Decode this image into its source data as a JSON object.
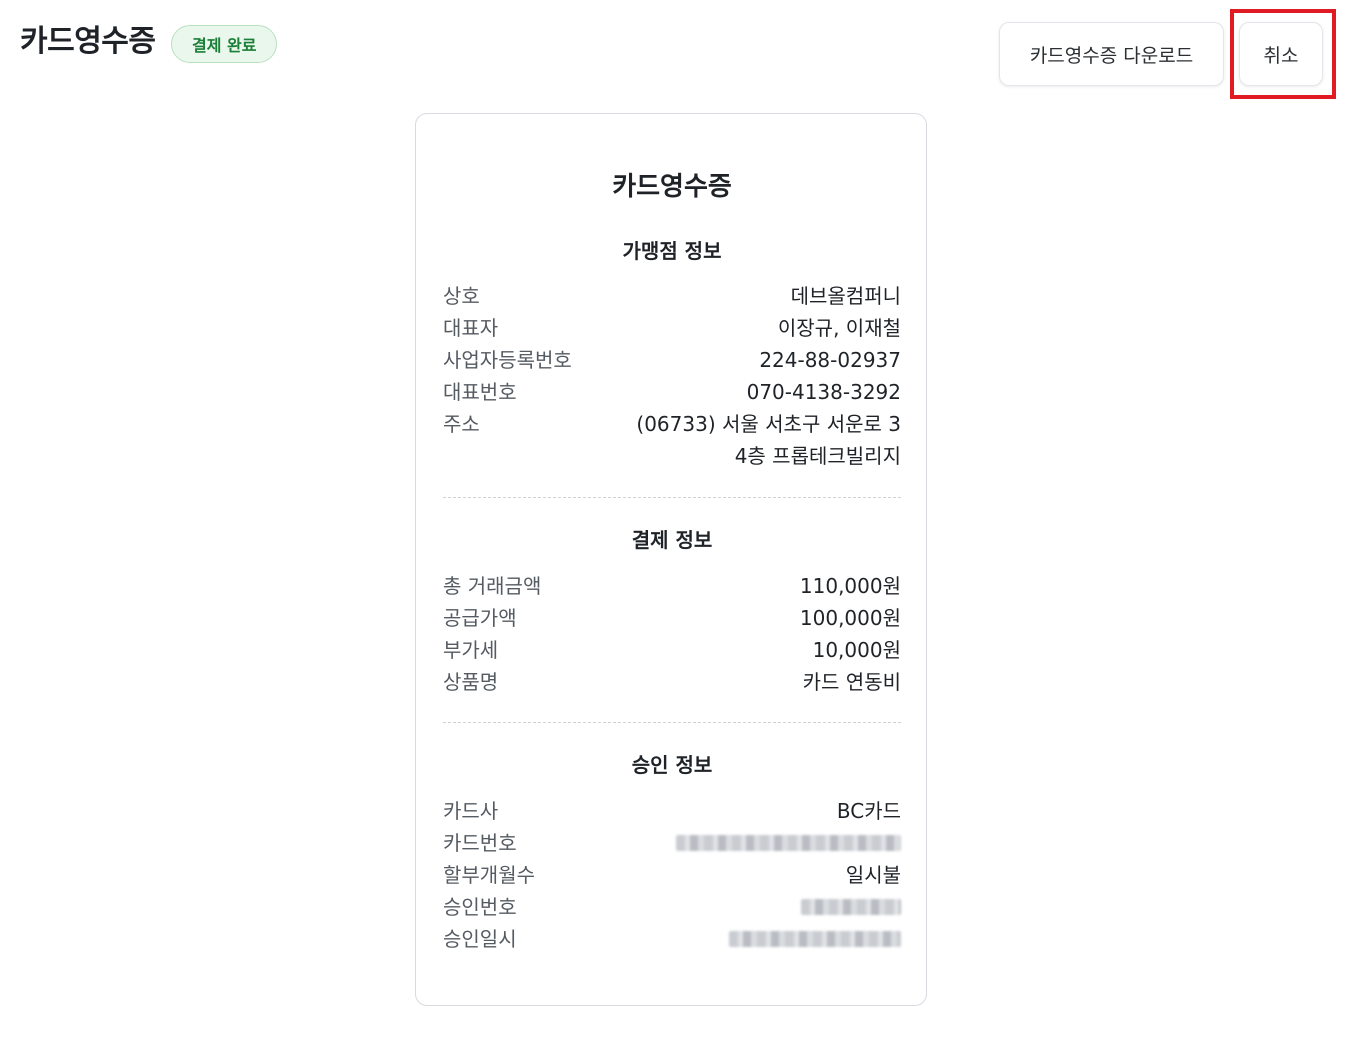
{
  "header": {
    "title": "카드영수증",
    "status_badge": "결제 완료",
    "download_label": "카드영수증 다운로드",
    "cancel_label": "취소"
  },
  "receipt": {
    "title": "카드영수증",
    "merchant": {
      "heading": "가맹점 정보",
      "rows": [
        {
          "label": "상호",
          "value": "데브올컴퍼니"
        },
        {
          "label": "대표자",
          "value": "이장규, 이재철"
        },
        {
          "label": "사업자등록번호",
          "value": "224-88-02937"
        },
        {
          "label": "대표번호",
          "value": "070-4138-3292"
        },
        {
          "label": "주소",
          "value_line1": "(06733) 서울 서초구 서운로 3",
          "value_line2": "4층 프롭테크빌리지"
        }
      ]
    },
    "payment": {
      "heading": "결제 정보",
      "rows": [
        {
          "label": "총 거래금액",
          "value": "110,000원"
        },
        {
          "label": "공급가액",
          "value": "100,000원"
        },
        {
          "label": "부가세",
          "value": "10,000원"
        },
        {
          "label": "상품명",
          "value": "카드 연동비"
        }
      ]
    },
    "approval": {
      "heading": "승인 정보",
      "rows": [
        {
          "label": "카드사",
          "value": "BC카드"
        },
        {
          "label": "카드번호"
        },
        {
          "label": "할부개월수",
          "value": "일시불"
        },
        {
          "label": "승인번호"
        },
        {
          "label": "승인일시"
        }
      ]
    }
  },
  "colors": {
    "badge_bg": "#eaf7ec",
    "badge_text": "#1a7f37",
    "highlight": "#e01b24"
  }
}
